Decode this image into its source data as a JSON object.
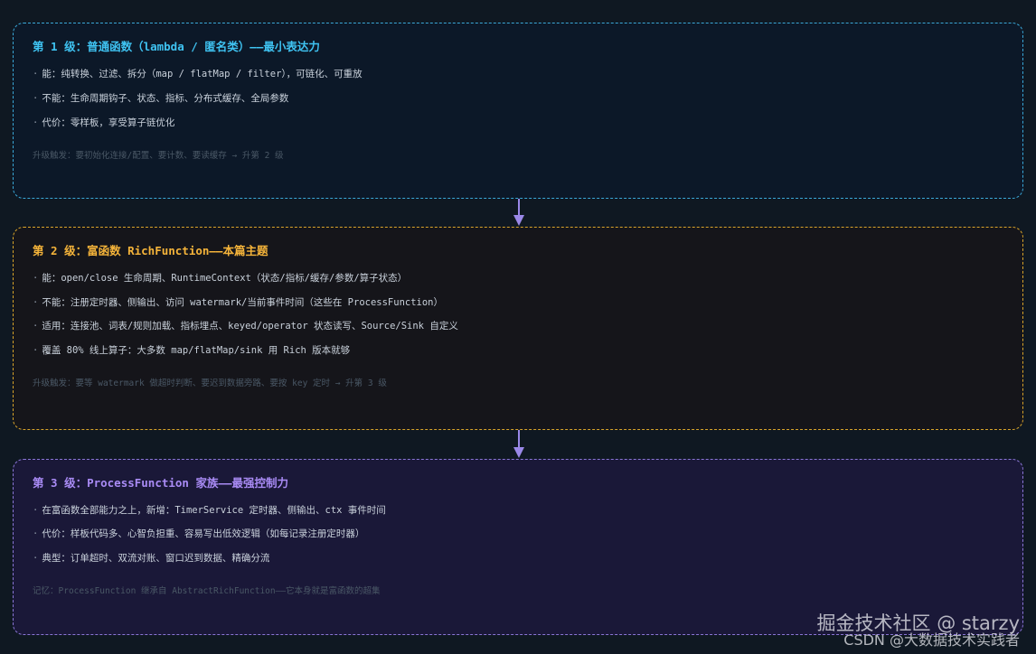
{
  "tiers": [
    {
      "title": "第 1 级：普通函数（lambda / 匿名类）——最小表达力",
      "color": "#3fc3f2",
      "bullets": [
        "能：纯转换、过滤、拆分（map / flatMap / filter），可链化、可重放",
        "不能：生命周期钩子、状态、指标、分布式缓存、全局参数",
        "代价：零样板，享受算子链优化"
      ],
      "note": "升级触发：要初始化连接/配置、要计数、要读缓存 → 升第 2 级"
    },
    {
      "title": "第 2 级：富函数 RichFunction——本篇主题",
      "color": "#f5b43a",
      "bullets": [
        "能：open/close 生命周期、RuntimeContext（状态/指标/缓存/参数/算子状态）",
        "不能：注册定时器、侧输出、访问 watermark/当前事件时间（这些在 ProcessFunction）",
        "适用：连接池、词表/规则加载、指标埋点、keyed/operator 状态读写、Source/Sink 自定义",
        "覆盖 80% 线上算子：大多数 map/flatMap/sink 用 Rich 版本就够"
      ],
      "note": "升级触发：要等 watermark 做超时判断、要迟到数据旁路、要按 key 定时 → 升第 3 级"
    },
    {
      "title": "第 3 级：ProcessFunction 家族——最强控制力",
      "color": "#a98bf5",
      "bullets": [
        "在富函数全部能力之上，新增：TimerService 定时器、侧输出、ctx 事件时间",
        "代价：样板代码多、心智负担重、容易写出低效逻辑（如每记录注册定时器）",
        "典型：订单超时、双流对账、窗口迟到数据、精确分流"
      ],
      "note": "记忆：ProcessFunction 继承自 AbstractRichFunction——它本身就是富函数的超集"
    }
  ],
  "arrow_color": "#9a88e8",
  "watermark": {
    "line1": "掘金技术社区 @ starzy",
    "line2": "CSDN @大数据技术实践者"
  }
}
